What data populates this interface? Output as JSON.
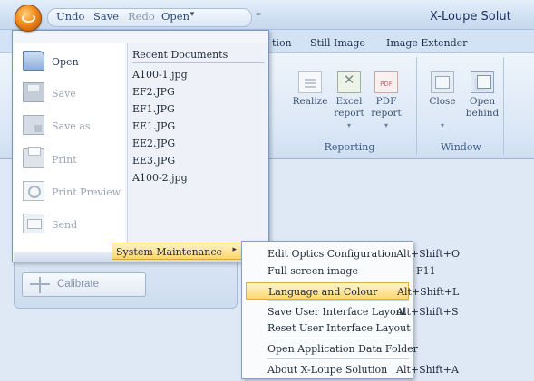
{
  "window": {
    "title": "X-Loupe Solut"
  },
  "quick_access": {
    "undo": "Undo",
    "save": "Save",
    "redo": "Redo",
    "open": "Open",
    "dropdown_icon": "chevron-down-icon",
    "customize_icon": "customize-qat-icon"
  },
  "ribbon_tabs": [
    "tion",
    "Still Image",
    "Image Extender"
  ],
  "ribbon": {
    "reporting": {
      "label": "Reporting",
      "buttons": [
        {
          "label": "Realize",
          "icon": "document-icon"
        },
        {
          "label": "Excel report",
          "icon": "excel-icon",
          "dropdown": "▾"
        },
        {
          "label": "PDF report",
          "icon": "pdf-icon",
          "dropdown": "▾"
        }
      ]
    },
    "window": {
      "label": "Window",
      "buttons": [
        {
          "label": "Close",
          "icon": "window-close-icon",
          "dropdown": "▾"
        },
        {
          "label": "Open behind",
          "icon": "window-stack-icon"
        }
      ]
    }
  },
  "app_menu": {
    "commands": [
      {
        "label": "Open",
        "icon": "folder-open-icon",
        "enabled": true
      },
      {
        "label": "Save",
        "icon": "save-icon",
        "enabled": false
      },
      {
        "label": "Save as",
        "icon": "save-as-icon",
        "enabled": false
      },
      {
        "label": "Print",
        "icon": "printer-icon",
        "enabled": false
      },
      {
        "label": "Print Preview",
        "icon": "print-preview-icon",
        "enabled": false
      },
      {
        "label": "Send",
        "icon": "send-icon",
        "enabled": false
      }
    ],
    "recent_title": "Recent Documents",
    "recent": [
      "A100-1.jpg",
      "EF2.JPG",
      "EF1.JPG",
      "EE1.JPG",
      "EE2.JPG",
      "EE3.JPG",
      "A100-2.jpg"
    ],
    "system_maintenance": "System Maintenance",
    "submenu_arrow": "▸"
  },
  "submenu": [
    {
      "label": "Edit Optics Configuration",
      "shortcut": "Alt+Shift+O"
    },
    {
      "label": "Full screen image",
      "shortcut": "F11"
    },
    {
      "label": "Language and Colour",
      "shortcut": "Alt+Shift+L",
      "highlighted": true
    },
    {
      "label": "Save User Interface Layout",
      "shortcut": "Alt+Shift+S"
    },
    {
      "label": "Reset User Interface Layout",
      "shortcut": ""
    },
    {
      "label": "Open Application Data Folder",
      "shortcut": ""
    },
    {
      "label": "About X-Loupe Solution",
      "shortcut": "Alt+Shift+A"
    }
  ],
  "workspace": {
    "calibrate": "Calibrate",
    "calibrate_icon": "crosshair-icon"
  },
  "colors": {
    "highlight": "#ffd873",
    "ribbon_bg": "#dce8f6",
    "orb": "#f08a1c"
  }
}
